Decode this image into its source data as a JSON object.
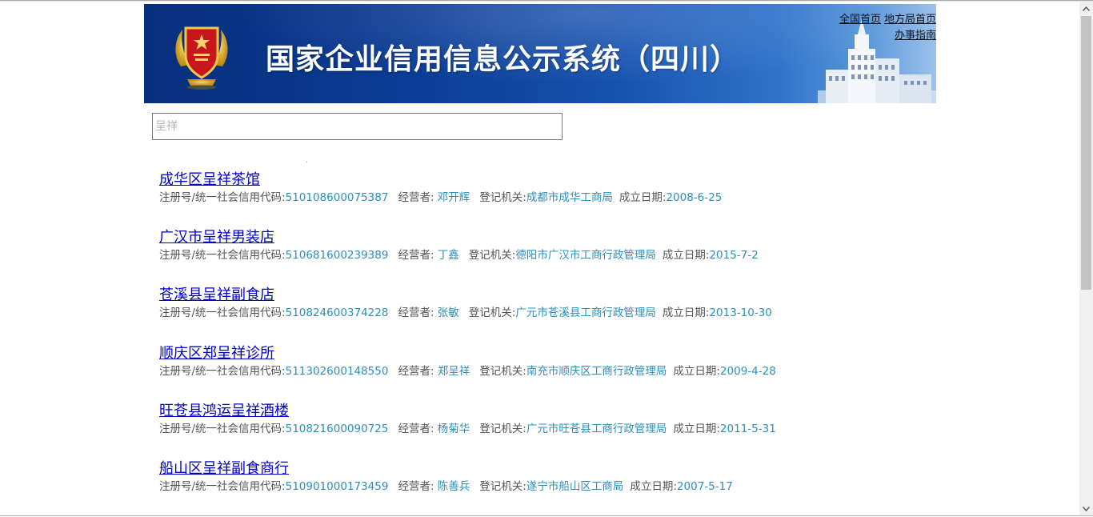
{
  "header": {
    "title": "国家企业信用信息公示系统（四川）",
    "links": {
      "national_home": "全国首页",
      "local_home": "地方局首页",
      "guide": "办事指南"
    }
  },
  "search": {
    "value": "",
    "placeholder": "呈祥"
  },
  "labels": {
    "reg_no": "注册号/统一社会信用代码:",
    "operator": "经营者: ",
    "authority": "登记机关:",
    "date": "成立日期:"
  },
  "results": [
    {
      "name": "成华区呈祥茶馆",
      "reg_no": "510108600075387",
      "operator": "邓开辉",
      "authority": "成都市成华工商局",
      "date": "2008-6-25"
    },
    {
      "name": "广汉市呈祥男装店",
      "reg_no": "510681600239389",
      "operator": "丁鑫",
      "authority": "德阳市广汉市工商行政管理局",
      "date": "2015-7-2"
    },
    {
      "name": "苍溪县呈祥副食店",
      "reg_no": "510824600374228",
      "operator": "张敏",
      "authority": "广元市苍溪县工商行政管理局",
      "date": "2013-10-30"
    },
    {
      "name": "顺庆区郑呈祥诊所",
      "reg_no": "511302600148550",
      "operator": "郑呈祥",
      "authority": "南充市顺庆区工商行政管理局",
      "date": "2009-4-28"
    },
    {
      "name": "旺苍县鸿运呈祥酒楼",
      "reg_no": "510821600090725",
      "operator": "杨菊华",
      "authority": "广元市旺苍县工商行政管理局",
      "date": "2011-5-31"
    },
    {
      "name": "船山区呈祥副食商行",
      "reg_no": "510901000173459",
      "operator": "陈善兵",
      "authority": "遂宁市船山区工商局",
      "date": "2007-5-17"
    }
  ],
  "icons": {
    "emblem": "national-emblem-icon",
    "building": "building-icon",
    "scroll_up": "chevron-up-icon",
    "scroll_down": "chevron-down-icon"
  },
  "colors": {
    "banner": "#0c3d95",
    "link": "#0000cc",
    "value": "#2b8fbd",
    "label": "#555555"
  }
}
